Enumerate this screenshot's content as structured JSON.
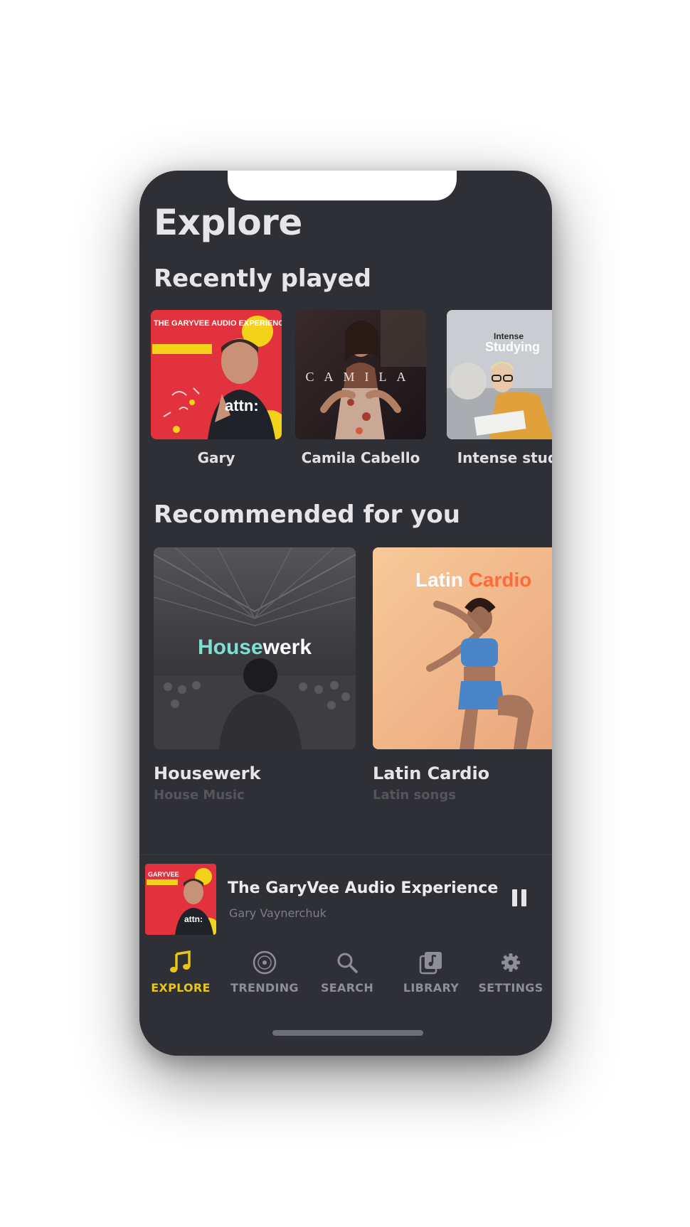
{
  "page": {
    "title": "Explore"
  },
  "recently_played": {
    "heading": "Recently played",
    "items": [
      {
        "label": "Gary",
        "art_text": "THE GARYVEE AUDIO EXPERIENCE",
        "art_text_2": "attn:"
      },
      {
        "label": "Camila Cabello",
        "art_text": "CAMILA"
      },
      {
        "label": "Intense study",
        "art_text": "Intense",
        "art_text_2": "Studying"
      }
    ]
  },
  "recommended": {
    "heading": "Recommended for you",
    "items": [
      {
        "title": "Housewerk",
        "subtitle": "House Music",
        "art_text_a": "House",
        "art_text_b": "werk"
      },
      {
        "title": "Latin Cardio",
        "subtitle": "Latin songs",
        "art_text_a": "Latin",
        "art_text_b": "Cardio"
      }
    ]
  },
  "now_playing": {
    "title": "The GaryVee Audio Experience",
    "artist": "Gary Vaynerchuk",
    "state": "playing"
  },
  "tabs": [
    {
      "label": "EXPLORE",
      "icon": "music-note-icon",
      "active": true
    },
    {
      "label": "TRENDING",
      "icon": "disc-icon",
      "active": false
    },
    {
      "label": "SEARCH",
      "icon": "search-icon",
      "active": false
    },
    {
      "label": "LIBRARY",
      "icon": "library-icon",
      "active": false
    },
    {
      "label": "SETTINGS",
      "icon": "gear-icon",
      "active": false
    }
  ],
  "colors": {
    "background": "#2f3035",
    "accent": "#e8c619",
    "housewerk_accent": "#7fe0d0",
    "latin_cardio_accent": "#ff6a3d"
  }
}
